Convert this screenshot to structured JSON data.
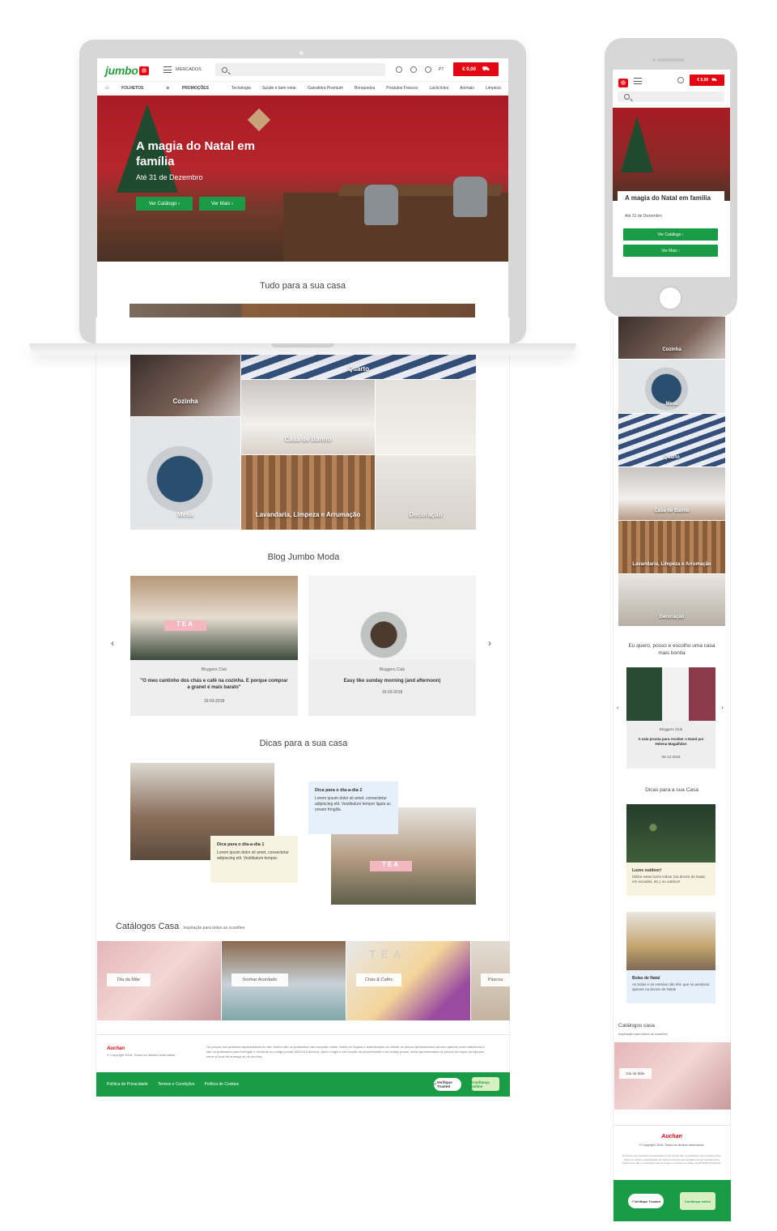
{
  "brand": {
    "logo": "jumbo",
    "footer_logo": "Auchan",
    "accent": "#e30613",
    "green": "#1a9b45"
  },
  "desktop": {
    "header": {
      "menu_label": "MERCADOS",
      "lang": "PT",
      "cart": "€ 0,00"
    },
    "nav": {
      "primary": [
        "FOLHETOS",
        "PROMOÇÕES"
      ],
      "categories": [
        "Tecnologia",
        "Saúde e bem estar",
        "Garrafeira Premium",
        "Brinquedos",
        "Produtos Frescos",
        "Lacticínios",
        "Animais",
        "Limpeza"
      ]
    },
    "hero": {
      "title": "A magia do Natal em família",
      "subtitle": "Até 31 de Dezembro",
      "btn_catalog": "Ver Catálogo ›",
      "btn_more": "Ver Mais ›"
    },
    "home": {
      "title": "Tudo para a sua casa",
      "tiles": {
        "kitchen": "Cozinha",
        "bedroom": "Quarto",
        "bath": "Casa de Banho",
        "table": "Mesa",
        "laundry": "Lavandaria, Limpeza e Arrumação",
        "decor": "Decoração"
      }
    },
    "blog": {
      "title": "Blog Jumbo Moda",
      "cards": [
        {
          "category": "Bloggers Club",
          "title": "\"O meu cantinho dos chás e café na cozinha. E porque comprar a granel é mais barato\"",
          "date": "19-03-2018",
          "img_text": "TEA"
        },
        {
          "category": "Bloggers Club",
          "title": "Easy like sunday morning (and afternoon)",
          "date": "15-03-2018"
        }
      ]
    },
    "tips": {
      "title": "Dicas para a sua casa",
      "tip1": {
        "title": "Dica para o dia-a-dia 1",
        "text": "Lorem ipsum dolor sit amet, consectetur adipiscing elit. Vestibulum tempor."
      },
      "tip2": {
        "title": "Dica para o dia-a-dia 2",
        "text": "Lorem ipsum dolor sit amet, consectetur adipiscing elit. Vestibulum tempor ligula ac ornare fringilla."
      },
      "img_text": "TEA"
    },
    "catalogs": {
      "title": "Catálogos Casa",
      "subtitle": "Inspiração para todos as ocasiões",
      "items": [
        "Dia da Mãe",
        "Sonhar Acordado",
        "Chás & Cafés",
        "Páscoa"
      ],
      "img_text": "TEA"
    },
    "footer": {
      "copyright": "© Copyright 2018. Todos os direitos reservados.",
      "legal": "Os preços dos produtos apresentados no site Jumbo são os praticados nas compras online. Antes do registo e autenticação do cliente os preços apresentados servem apenas como referência e são os praticados para entregas e recolhas no código postal 2600-615 Alverca. Após o login e em função da preservidade e do código postal, serão apresentados os preços em vigor na loja que serve a local de entrega ou de recolha.",
      "links": [
        "Política de Privacidade",
        "Termos e Condições",
        "Política de Cookies"
      ],
      "badge1": "Verifique Trusted",
      "badge2": "Confiança online"
    }
  },
  "mobile": {
    "cart": "€ 0,00",
    "hero": {
      "title": "A magia do Natal em família",
      "subtitle": "Até 31 de Dezembro",
      "btn_catalog": "Ver Catálogo ›",
      "btn_more": "Ver Mais ›"
    },
    "tiles": [
      "Cozinha",
      "Mesa",
      "Quarto",
      "Casa de Banho",
      "Lavandaria, Limpeza e Arrumação",
      "Decoração"
    ],
    "blog": {
      "title": "Eu quero, posso e escolho uma casa mais bonita",
      "category": "Bloggers Club",
      "card_title": "A sala pronta para receber o Natal por Helena Magalhães",
      "date": "06-12-2018"
    },
    "tips": {
      "title": "Dicas para a sua Casa",
      "tip1": {
        "title": "Luzes outdoor!",
        "text": "Utilize estas luzes indoor (na árvore de Natal, em escadas, etc.) ou outdoor!"
      },
      "tip2": {
        "title": "Bolas de Natal",
        "text": "As bolas e as estrelas não têm que se pendurar apenas na árvore de Natal!"
      }
    },
    "catalogs": {
      "title": "Catálogos casa",
      "subtitle": "Inspiração para todos os ocasiões",
      "item": "Dia da Mãe"
    },
    "footer": {
      "copyright": "© Copyright 2018. Todos os direitos reservados.",
      "legal": "Os preços dos produtos apresentados no site Jumbo são os praticados nas compras online. Antes do registo e autenticação do cliente os preços apresentados servem apenas como referência e são os praticados para entregas e recolhas no código postal 2600-615 Alverca.",
      "badge1": "Verifique Trusted",
      "badge2": "Confiança online"
    }
  }
}
